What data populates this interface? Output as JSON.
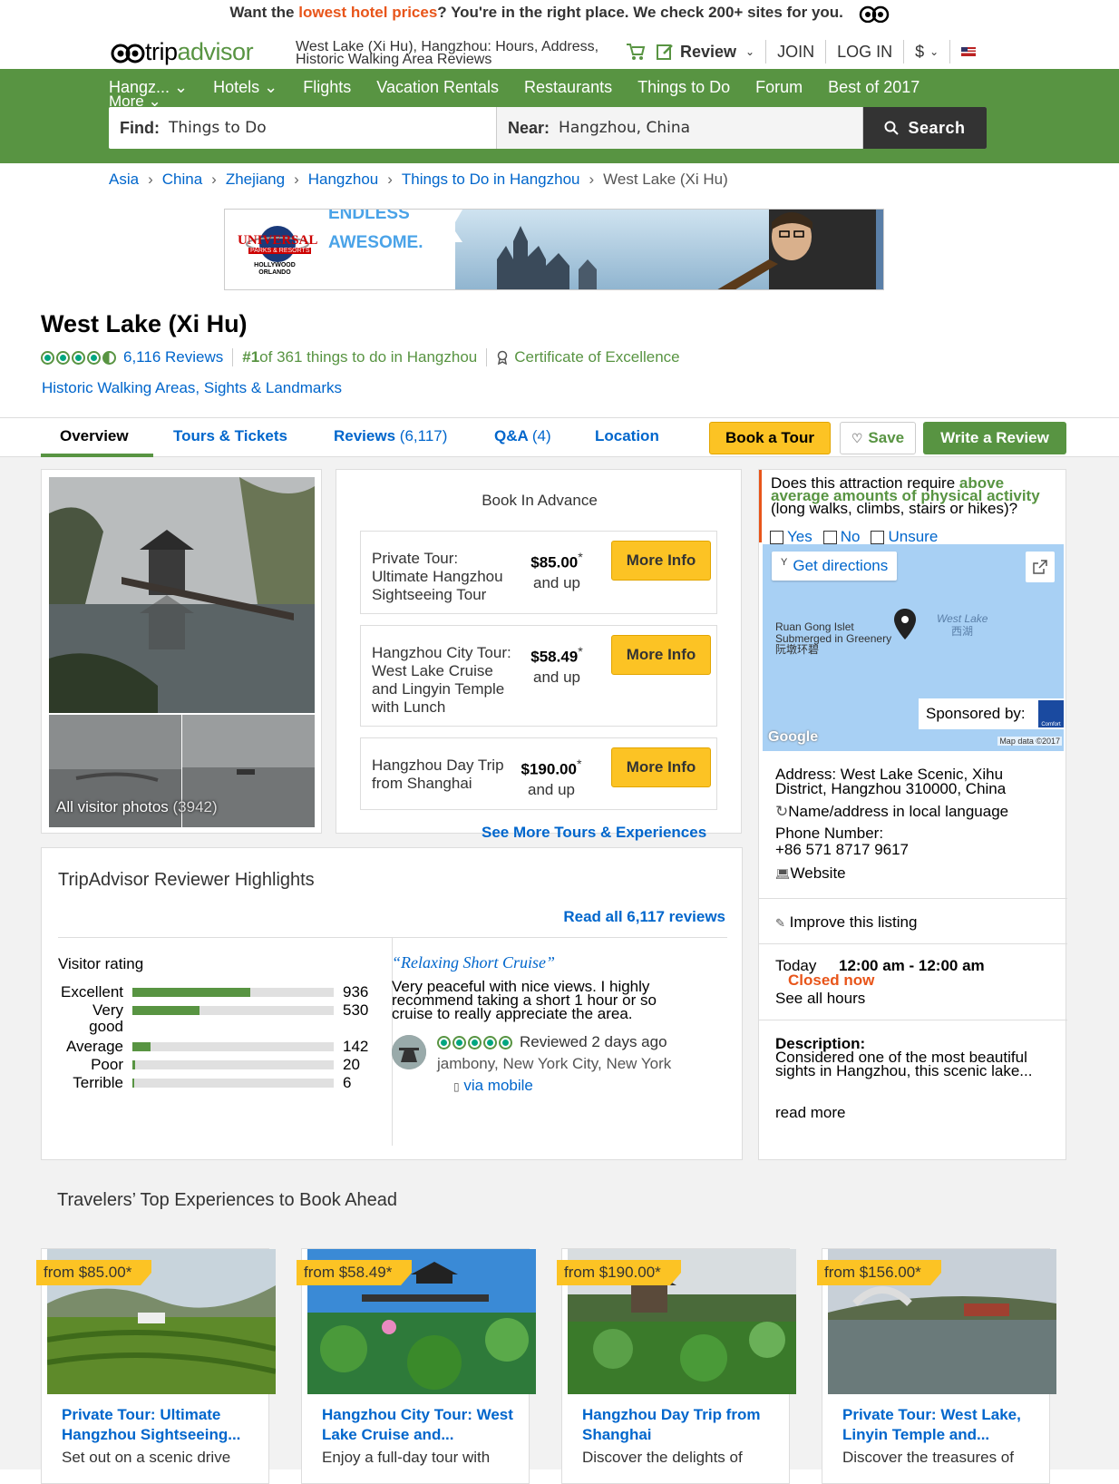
{
  "promo": {
    "before": "Want the ",
    "highlight": "lowest hotel prices",
    "after": "? You're in the right place. We check 200+ sites for you."
  },
  "logo": {
    "part1": "trip",
    "part2": "advisor"
  },
  "page_title": "West Lake (Xi Hu), Hangzhou: Hours, Address, Historic Walking Area Reviews",
  "topnav": {
    "review": "Review",
    "join": "JOIN",
    "login": "LOG IN",
    "currency": "$"
  },
  "mainnav": {
    "items": [
      "Hangz...",
      "Hotels",
      "Flights",
      "Vacation Rentals",
      "Restaurants",
      "Things to Do",
      "Forum",
      "Best of 2017"
    ],
    "more": "More"
  },
  "search": {
    "find_label": "Find:",
    "find_value": "Things to Do",
    "near_label": "Near:",
    "near_value": "Hangzhou, China",
    "button": "Search"
  },
  "breadcrumbs": [
    "Asia",
    "China",
    "Zhejiang",
    "Hangzhou",
    "Things to Do in Hangzhou",
    "West Lake (Xi Hu)"
  ],
  "banner": {
    "brand": "UNIVERSAL",
    "brand_sub": "PARKS & RESORTS",
    "brand_loc": "HOLLYWOOD ORLANDO",
    "line1": "ENDLESS",
    "line2": "AWESOME."
  },
  "attraction": {
    "name": "West Lake (Xi Hu)",
    "reviews": "6,116 Reviews",
    "rank_num": "#1",
    "rank_text": " of 361 things to do in Hangzhou",
    "certificate": "Certificate of Excellence",
    "categories": "Historic Walking Areas, Sights & Landmarks",
    "rating": 4.5
  },
  "tabs": {
    "overview": "Overview",
    "tours": "Tours & Tickets",
    "reviews": "Reviews",
    "reviews_count": "(6,117)",
    "qa": "Q&A",
    "qa_count": "(4)",
    "location": "Location"
  },
  "actions": {
    "book": "Book a Tour",
    "save": "Save",
    "write": "Write a Review"
  },
  "photos": {
    "label": "All visitor photos",
    "count": "(3942)"
  },
  "book": {
    "title": "Book In Advance",
    "tours": [
      {
        "name": "Private Tour: Ultimate Hangzhou Sightseeing Tour",
        "price": "$85.00",
        "star": "*",
        "unit": "and up",
        "button": "More Info"
      },
      {
        "name": "Hangzhou City Tour: West Lake Cruise and Lingyin Temple with Lunch",
        "price": "$58.49",
        "star": "*",
        "unit": "and up",
        "button": "More Info"
      },
      {
        "name": "Hangzhou Day Trip from Shanghai",
        "price": "$190.00",
        "star": "*",
        "unit": "and up",
        "button": "More Info"
      }
    ],
    "see_more": "See More Tours & Experiences"
  },
  "physical": {
    "q1": "Does this attraction require ",
    "q_hl": "above average amounts of physical activity",
    "q2": " (long walks, climbs, stairs or hikes)?",
    "yes": "Yes",
    "no": "No",
    "unsure": "Unsure"
  },
  "map": {
    "get_directions": "Get directions",
    "label_islet": "Ruan Gong Islet",
    "label_sub": "Submerged in Greenery",
    "label_cn": "阮墩环碧",
    "lake": "West Lake",
    "lake_cn": "西湖",
    "sponsored": "Sponsored by:",
    "sponsor_logo": "Comfort",
    "google": "Google",
    "mapdata": "Map data ©2017"
  },
  "info": {
    "address": "Address: West Lake Scenic, Xihu District, Hangzhou 310000, China",
    "local_name": "Name/address in local language",
    "phone_label": "Phone Number:",
    "phone": "+86 571 8717 9617",
    "website": "Website",
    "improve": "Improve this listing",
    "today": "Today",
    "hours": "12:00 am - 12:00 am",
    "closed": "Closed now",
    "see_hours": "See all hours",
    "desc_label": "Description:",
    "desc": "Considered one of the most beautiful sights in Hangzhou, this scenic lake...",
    "read_more": "read more"
  },
  "highlights": {
    "title": "TripAdvisor Reviewer Highlights",
    "read_all": "Read all 6,117 reviews",
    "visitor_rating": "Visitor rating",
    "ratings": [
      {
        "label": "Excellent",
        "count": "936",
        "value": 936
      },
      {
        "label": "Very good",
        "count": "530",
        "value": 530
      },
      {
        "label": "Average",
        "count": "142",
        "value": 142
      },
      {
        "label": "Poor",
        "count": "20",
        "value": 20
      },
      {
        "label": "Terrible",
        "count": "6",
        "value": 6
      }
    ],
    "quote_title": "“Relaxing Short Cruise”",
    "quote_body": "Very peaceful with nice views. I highly recommend taking a short 1 hour or so cruise to really appreciate the area.",
    "reviewed": "Reviewed 2 days ago",
    "reviewer": "jambony, New York City, New York",
    "via": "via mobile",
    "review_rating": 5
  },
  "experiences": {
    "title": "Travelers’ Top Experiences to Book Ahead",
    "items": [
      {
        "price": "from $85.00*",
        "title": "Private Tour: Ultimate Hangzhou Sightseeing...",
        "desc": "Set out on a scenic drive"
      },
      {
        "price": "from $58.49*",
        "title": "Hangzhou City Tour: West Lake Cruise and...",
        "desc": "Enjoy a full-day tour with"
      },
      {
        "price": "from $190.00*",
        "title": "Hangzhou Day Trip from Shanghai",
        "desc": "Discover the delights of"
      },
      {
        "price": "from $156.00*",
        "title": "Private Tour: West Lake, Linyin Temple and...",
        "desc": "Discover the treasures of"
      }
    ]
  },
  "colors": {
    "green": "#589442",
    "yellow": "#fcc324",
    "link": "#0066cc",
    "orange": "#e8551a"
  }
}
